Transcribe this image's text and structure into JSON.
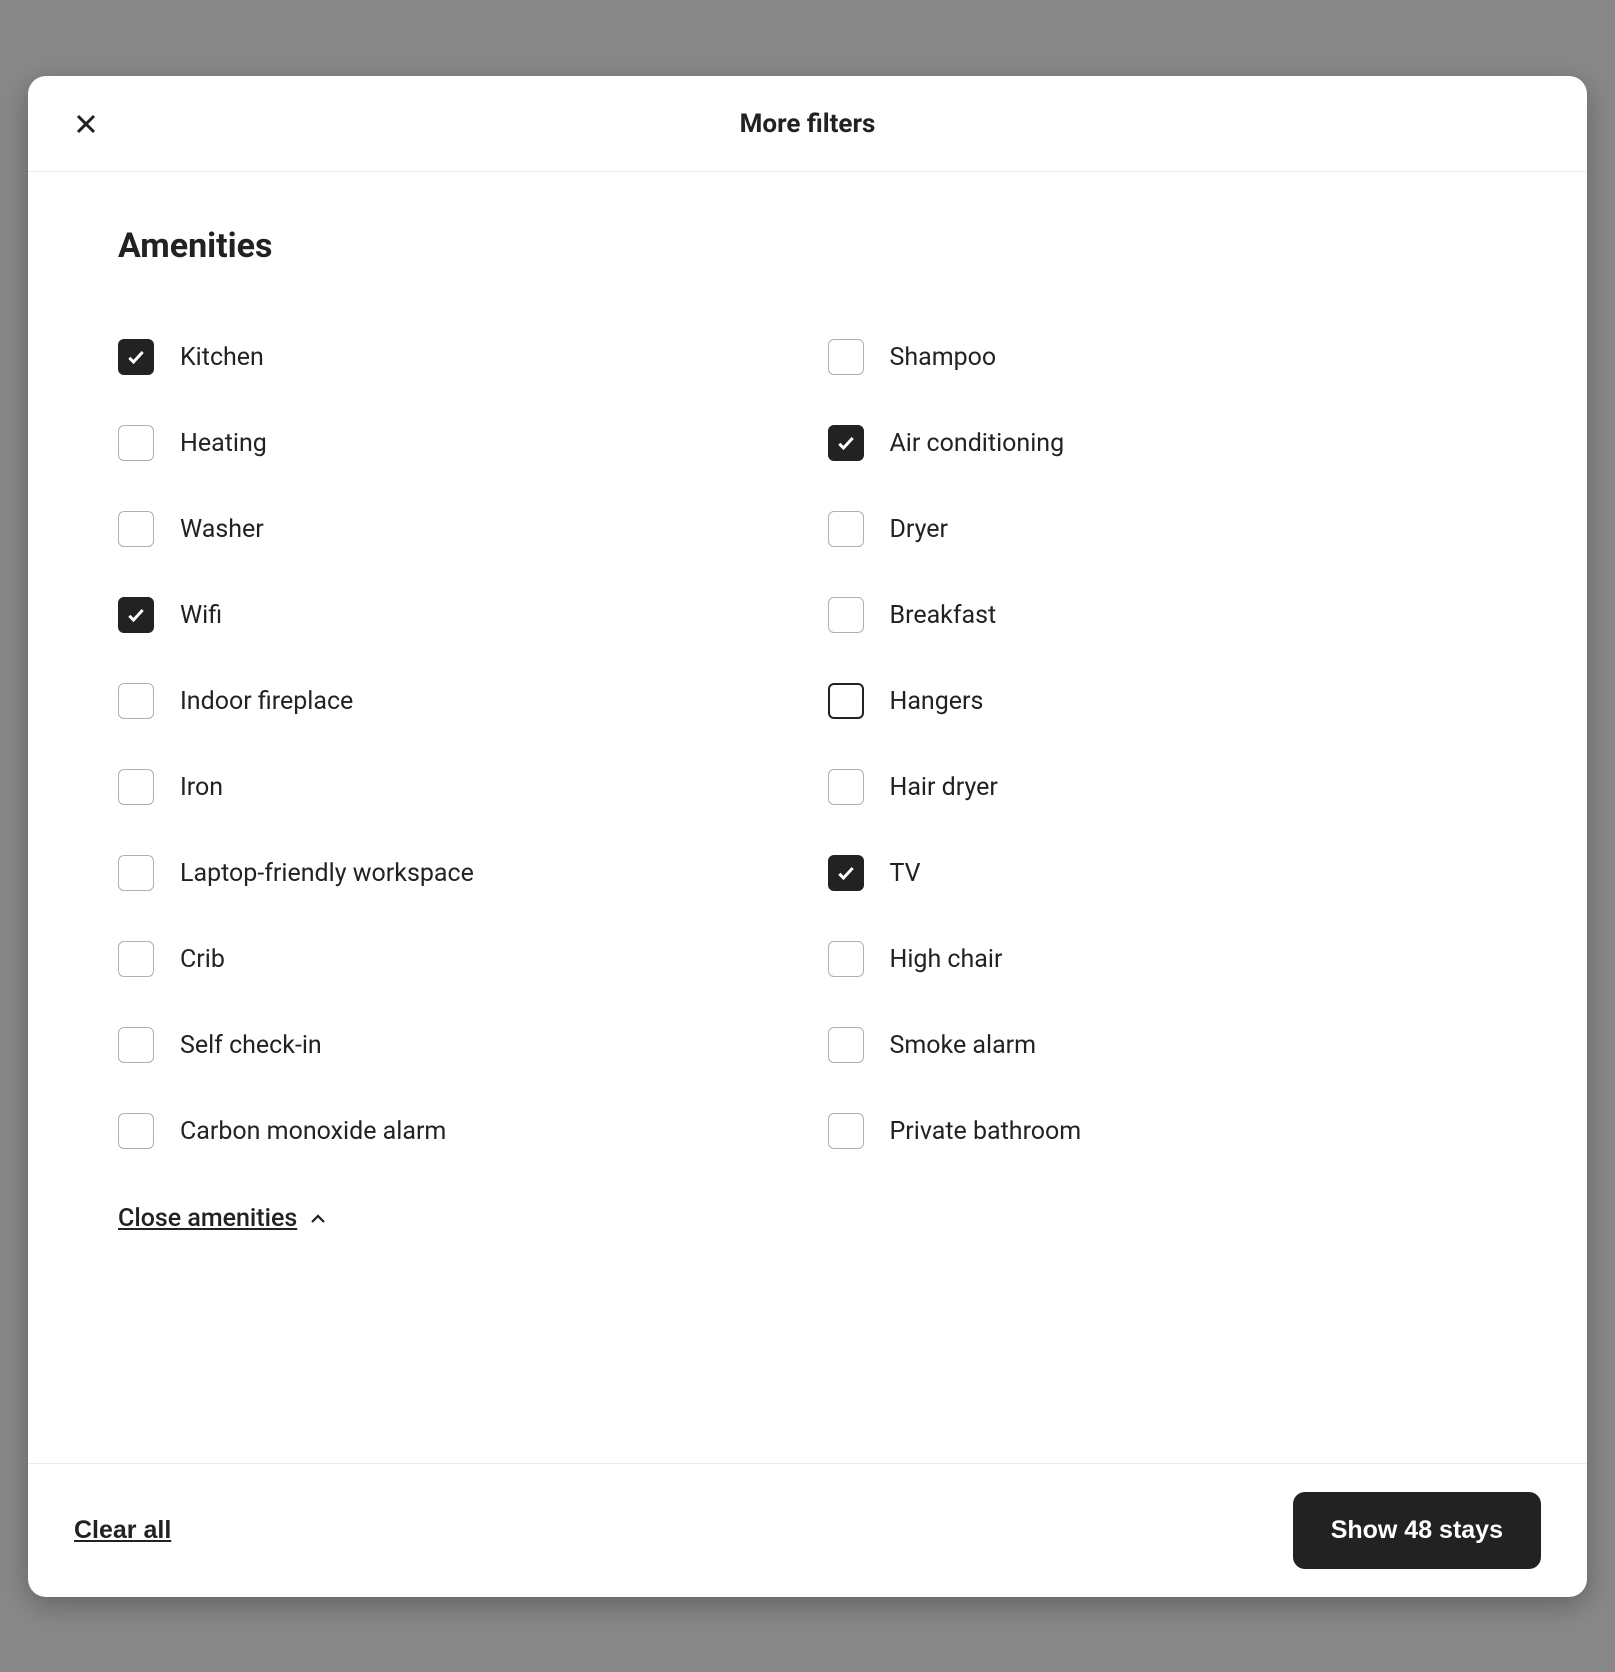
{
  "modal": {
    "title": "More filters",
    "section_title": "Amenities",
    "close_section_label": "Close amenities",
    "clear_all_label": "Clear all",
    "show_stays_label": "Show 48 stays"
  },
  "amenities": {
    "left": [
      {
        "label": "Kitchen",
        "checked": true,
        "highlight": false
      },
      {
        "label": "Heating",
        "checked": false,
        "highlight": false
      },
      {
        "label": "Washer",
        "checked": false,
        "highlight": false
      },
      {
        "label": "Wifi",
        "checked": false,
        "highlight": false
      },
      {
        "label": "Indoor fireplace",
        "checked": false,
        "highlight": false
      },
      {
        "label": "Iron",
        "checked": false,
        "highlight": false
      },
      {
        "label": "Laptop-friendly workspace",
        "checked": false,
        "highlight": false
      },
      {
        "label": "Crib",
        "checked": false,
        "highlight": false
      },
      {
        "label": "Self check-in",
        "checked": false,
        "highlight": false
      },
      {
        "label": "Carbon monoxide alarm",
        "checked": false,
        "highlight": false
      }
    ],
    "right": [
      {
        "label": "Shampoo",
        "checked": false,
        "highlight": false
      },
      {
        "label": "Air conditioning",
        "checked": true,
        "highlight": false
      },
      {
        "label": "Dryer",
        "checked": false,
        "highlight": false
      },
      {
        "label": "Breakfast",
        "checked": false,
        "highlight": false
      },
      {
        "label": "Hangers",
        "checked": false,
        "highlight": true
      },
      {
        "label": "Hair dryer",
        "checked": false,
        "highlight": false
      },
      {
        "label": "TV",
        "checked": true,
        "highlight": false
      },
      {
        "label": "High chair",
        "checked": false,
        "highlight": false
      },
      {
        "label": "Smoke alarm",
        "checked": false,
        "highlight": false
      },
      {
        "label": "Private bathroom",
        "checked": false,
        "highlight": false
      }
    ]
  },
  "checked_override": {
    "Wifi": true
  }
}
